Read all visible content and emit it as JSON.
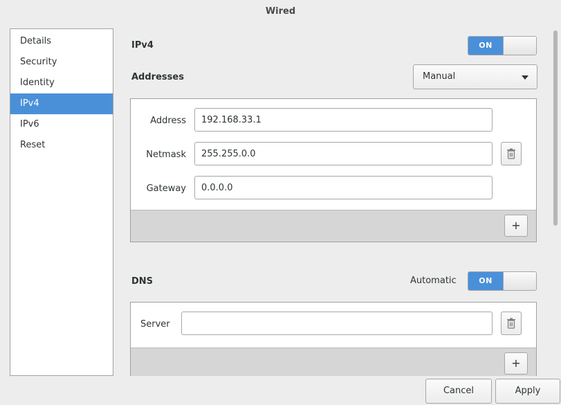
{
  "window": {
    "title": "Wired"
  },
  "sidebar": {
    "items": [
      {
        "label": "Details"
      },
      {
        "label": "Security"
      },
      {
        "label": "Identity"
      },
      {
        "label": "IPv4",
        "selected": true
      },
      {
        "label": "IPv6"
      },
      {
        "label": "Reset"
      }
    ]
  },
  "ipv4": {
    "title": "IPv4",
    "switch_label": "ON",
    "addresses": {
      "title": "Addresses",
      "method": "Manual",
      "fields": {
        "address": {
          "label": "Address",
          "value": "192.168.33.1"
        },
        "netmask": {
          "label": "Netmask",
          "value": "255.255.0.0"
        },
        "gateway": {
          "label": "Gateway",
          "value": "0.0.0.0"
        }
      },
      "add_label": "+"
    }
  },
  "dns": {
    "title": "DNS",
    "automatic_label": "Automatic",
    "switch_label": "ON",
    "server": {
      "label": "Server",
      "value": ""
    },
    "add_label": "+"
  },
  "actions": {
    "cancel": "Cancel",
    "apply": "Apply"
  },
  "colors": {
    "accent": "#4a90d9",
    "background": "#ededed"
  },
  "icons": {
    "delete": "trash-icon",
    "dropdown": "chevron-down-icon"
  }
}
